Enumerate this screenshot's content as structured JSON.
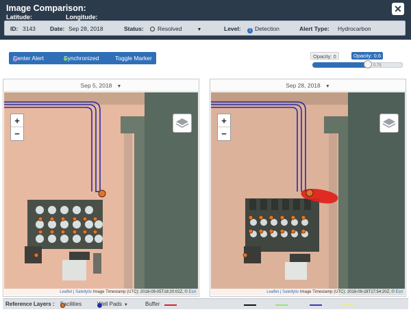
{
  "header": {
    "title": "Image Comparison:",
    "latitude_label": "Latitude:",
    "longitude_label": "Longitude:",
    "close_glyph": "✕"
  },
  "info_bar": {
    "id_label": "ID:",
    "id_value": "3143",
    "date_label": "Date:",
    "date_value": "Sep 28, 2018",
    "status_label": "Status:",
    "status_value": "Resolved",
    "level_label": "Level:",
    "level_value": "Detection",
    "alert_type_label": "Alert Type:",
    "alert_type_value": "Hydrocarbon"
  },
  "controls": {
    "center_alert": "Center Alert",
    "synchronized": "Synchronized",
    "toggle_marker": "Toggle Marker"
  },
  "opacity": {
    "left_label": "Opacity: 0",
    "right_label": "Opacity: 0.6",
    "slider_value": "0.75",
    "slider_level": 0.62
  },
  "panels": {
    "left": {
      "date": "Sep 5, 2018",
      "attribution_links": "Leaflet | Satellytix",
      "attribution_text": " Image Timestamp (UTC): 2018-09-05T18:20:02Z, © ",
      "attribution_esri": "Esri"
    },
    "right": {
      "date": "Sep 28, 2018",
      "attribution_links": "Leaflet | Satellytix",
      "attribution_text": " Image Timestamp (UTC): 2018-09-28T17:54:20Z, © ",
      "attribution_esri": "Esri"
    },
    "zoom_in": "+",
    "zoom_out": "−"
  },
  "reference_layers": {
    "label": "Reference Layers :",
    "facilities": "Facilities",
    "well_pads": "Well Pads",
    "buffer": "Buffer"
  },
  "colors": {
    "header_bg": "#2b3b4c",
    "accent": "#2f6fb7",
    "facility_dot": "#e0752a",
    "well_pad": "#2a2aa6",
    "spill": "#e0201a",
    "buffer": "#d9232a"
  },
  "icons": {
    "close": "close-icon",
    "layers": "layers-icon",
    "status_dot": "circle-icon",
    "level_info": "info-icon",
    "dropdown": "chevron-down-icon"
  }
}
